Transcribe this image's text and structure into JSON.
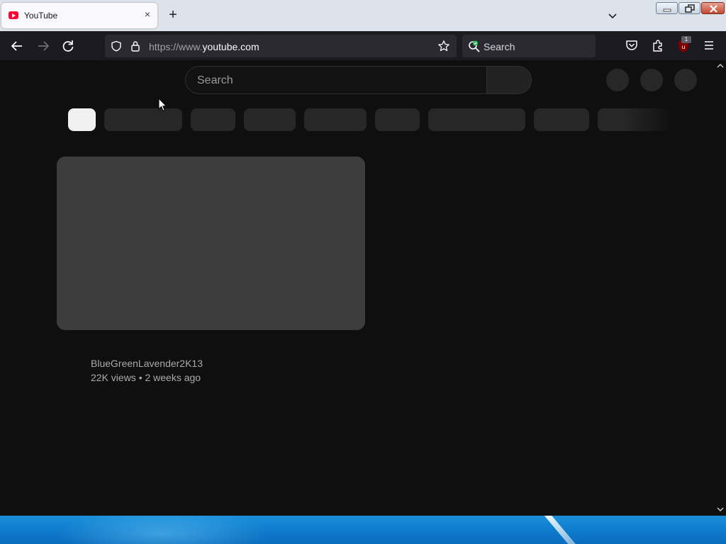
{
  "browser": {
    "tab": {
      "title": "YouTube",
      "close_glyph": "×"
    },
    "new_tab_glyph": "+",
    "url": {
      "prefix": "https://www.",
      "domain": "youtube.com"
    },
    "search_placeholder": "Search",
    "extension_badge": "1"
  },
  "youtube": {
    "search_placeholder": "Search",
    "video": {
      "channel": "BlueGreenLavender2K13",
      "meta": "22K views • 2 weeks ago"
    }
  },
  "colors": {
    "page_bg": "#0f0f0f",
    "placeholder_block": "#272727",
    "thumbnail_placeholder": "#3d3d3d",
    "active_chip": "#f1f1f1",
    "youtube_red": "#ff0033"
  },
  "icons": [
    "back-icon",
    "forward-icon",
    "reload-icon",
    "shield-icon",
    "lock-icon",
    "star-icon",
    "search-engine-icon",
    "pocket-icon",
    "extensions-icon",
    "ublock-icon",
    "menu-icon",
    "chevron-down-icon",
    "minimize-icon",
    "restore-icon",
    "close-icon"
  ]
}
